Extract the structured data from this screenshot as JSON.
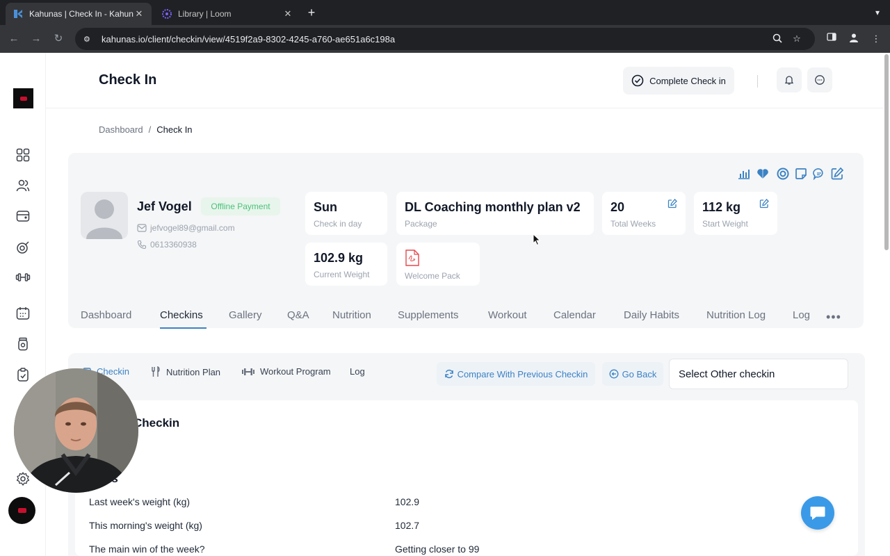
{
  "browser": {
    "tabs": [
      {
        "title": "Kahunas | Check In - Kahunas",
        "active": true
      },
      {
        "title": "Library | Loom",
        "active": false
      }
    ],
    "url": "kahunas.io/client/checkin/view/4519f2a9-8302-4245-a760-ae651a6c198a"
  },
  "header": {
    "title": "Check In",
    "complete_button": "Complete Check in"
  },
  "breadcrumb": {
    "root": "Dashboard",
    "separator": "/",
    "current": "Check In"
  },
  "client": {
    "name": "Jef Vogel",
    "payment_badge": "Offline Payment",
    "email": "jefvogel89@gmail.com",
    "phone": "0613360938"
  },
  "stats": {
    "checkin_day": {
      "value": "Sun",
      "label": "Check in day"
    },
    "package": {
      "value": "DL Coaching monthly plan v2",
      "label": "Package"
    },
    "total_weeks": {
      "value": "20",
      "label": "Total Weeks"
    },
    "start_weight": {
      "value": "112 kg",
      "label": "Start Weight"
    },
    "current_weight": {
      "value": "102.9 kg",
      "label": "Current Weight"
    },
    "welcome_pack": {
      "label": "Welcome Pack"
    }
  },
  "main_tabs": [
    "Dashboard",
    "Checkins",
    "Gallery",
    "Q&A",
    "Nutrition",
    "Supplements",
    "Workout",
    "Calendar",
    "Daily Habits",
    "Nutrition Log",
    "Log"
  ],
  "active_main_tab": "Checkins",
  "sub_tabs": {
    "checkin": "Checkin",
    "nutrition_plan": "Nutrition Plan",
    "workout_program": "Workout Program",
    "log": "Log"
  },
  "actions": {
    "compare": "Compare With Previous Checkin",
    "go_back": "Go Back",
    "select_other": "Select Other checkin"
  },
  "checkin_section": {
    "title": "Checkin",
    "subtitle_partial": "os",
    "rows": [
      {
        "q": "Last week's weight (kg)",
        "a": "102.9"
      },
      {
        "q": "This morning's weight (kg)",
        "a": "102.7"
      },
      {
        "q": "The main win of the week?",
        "a": "Getting closer to 99"
      }
    ]
  },
  "colors": {
    "accent": "#3b82c4",
    "badge_green": "#4cc17a",
    "chat_fab": "#3a9ae8"
  }
}
